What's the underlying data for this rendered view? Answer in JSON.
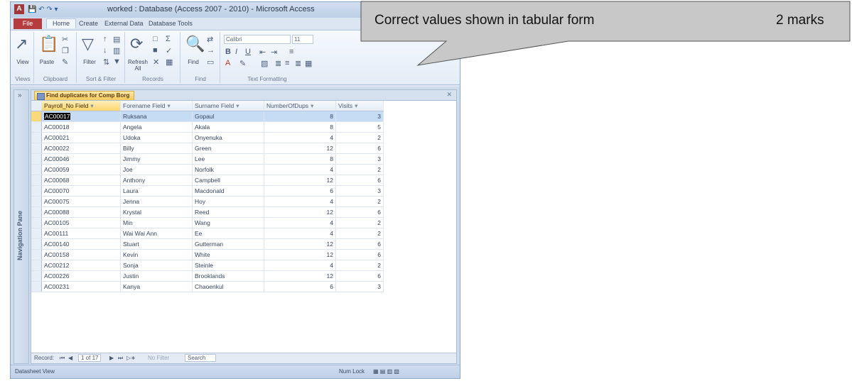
{
  "window": {
    "title": "worked : Database (Access 2007 - 2010) - Microsoft Access",
    "tabs": [
      "File",
      "Home",
      "Create",
      "External Data",
      "Database Tools"
    ]
  },
  "ribbon": {
    "view_label": "View",
    "paste_label": "Paste",
    "filter_label": "Filter",
    "refresh_label": "Refresh All",
    "find_label": "Find",
    "font_name": "Calibri",
    "font_size": "11",
    "groups": [
      "Views",
      "Clipboard",
      "Sort & Filter",
      "Records",
      "Find",
      "Text Formatting"
    ]
  },
  "nav_pane": {
    "label": "Navigation Pane"
  },
  "query_tab": {
    "label": "Find duplicates for Comp Borg"
  },
  "table": {
    "columns": [
      "Payroll_No Field",
      "Forename Field",
      "Surname Field",
      "NumberOfDups",
      "Visits"
    ],
    "rows": [
      [
        "AC00017",
        "Ruksana",
        "Gopaul",
        "8",
        "3"
      ],
      [
        "AC00018",
        "Angela",
        "Akala",
        "8",
        "5"
      ],
      [
        "AC00021",
        "Udoka",
        "Onyenuka",
        "4",
        "2"
      ],
      [
        "AC00022",
        "Billy",
        "Green",
        "12",
        "6"
      ],
      [
        "AC00046",
        "Jimmy",
        "Lee",
        "8",
        "3"
      ],
      [
        "AC00059",
        "Joe",
        "Norfolk",
        "4",
        "2"
      ],
      [
        "AC00068",
        "Anthony",
        "Campbell",
        "12",
        "6"
      ],
      [
        "AC00070",
        "Laura",
        "Macdonald",
        "6",
        "3"
      ],
      [
        "AC00075",
        "Jenna",
        "Hoy",
        "4",
        "2"
      ],
      [
        "AC00088",
        "Krystal",
        "Reed",
        "12",
        "6"
      ],
      [
        "AC00105",
        "Min",
        "Wang",
        "4",
        "2"
      ],
      [
        "AC00111",
        "Wai Wai Ann",
        "Ee",
        "4",
        "2"
      ],
      [
        "AC00140",
        "Stuart",
        "Gutterman",
        "12",
        "6"
      ],
      [
        "AC00158",
        "Kevin",
        "White",
        "12",
        "6"
      ],
      [
        "AC00212",
        "Sonja",
        "Steinle",
        "4",
        "2"
      ],
      [
        "AC00226",
        "Justin",
        "Brooklands",
        "12",
        "6"
      ],
      [
        "AC00231",
        "Kanya",
        "Chaoenkul",
        "6",
        "3"
      ]
    ]
  },
  "record_nav": {
    "record_label": "Record:",
    "position": "1 of 17",
    "filter": "No Filter",
    "search": "Search"
  },
  "status": {
    "left": "Datasheet View",
    "right": "Num Lock"
  },
  "callout": {
    "text": "Correct values shown in tabular form",
    "marks": "2 marks",
    "fill": "#c8c8c8"
  }
}
